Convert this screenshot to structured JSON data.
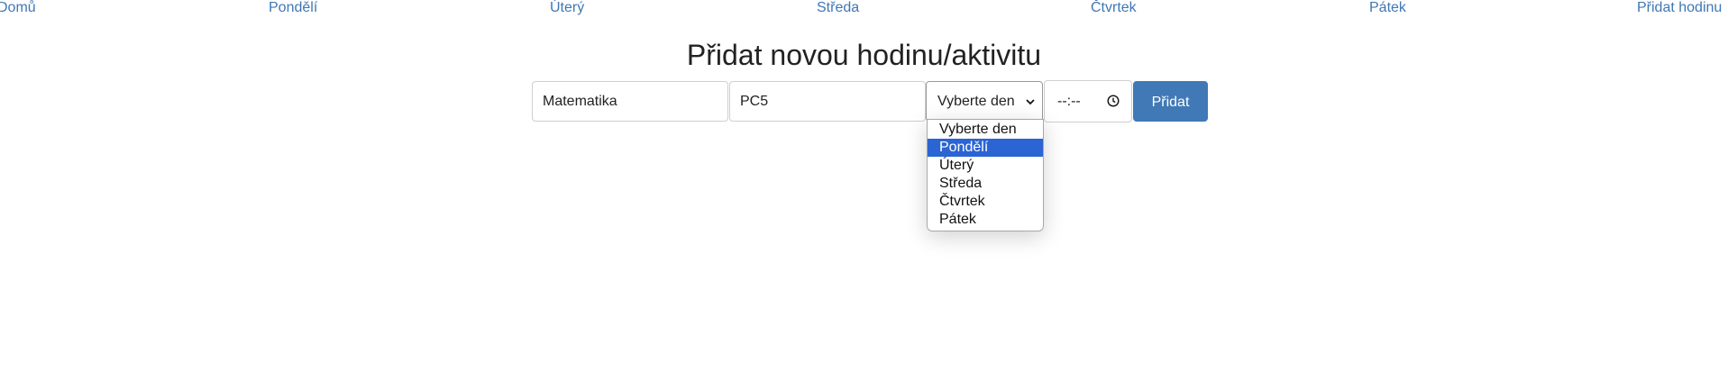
{
  "nav": {
    "items": [
      "Domů",
      "Pondělí",
      "Úterý",
      "Středa",
      "Čtvrtek",
      "Pátek",
      "Přidat hodinu"
    ],
    "color": "#3f78b4"
  },
  "form": {
    "title": "Přidat novou hodinu/aktivitu",
    "subject_value": "Matematika",
    "room_value": "PC5",
    "day_select_value": "Vyberte den",
    "time_value": "--:--",
    "submit_label": "Přidat",
    "submit_color": "#4079b6"
  },
  "day_dropdown": {
    "options": [
      "Vyberte den",
      "Pondělí",
      "Úterý",
      "Středa",
      "Čtvrtek",
      "Pátek"
    ],
    "highlighted": "Pondělí",
    "highlight_color": "#2b64d3"
  },
  "icons": {
    "time": "clock-icon",
    "select": "chevron-down-icon"
  }
}
